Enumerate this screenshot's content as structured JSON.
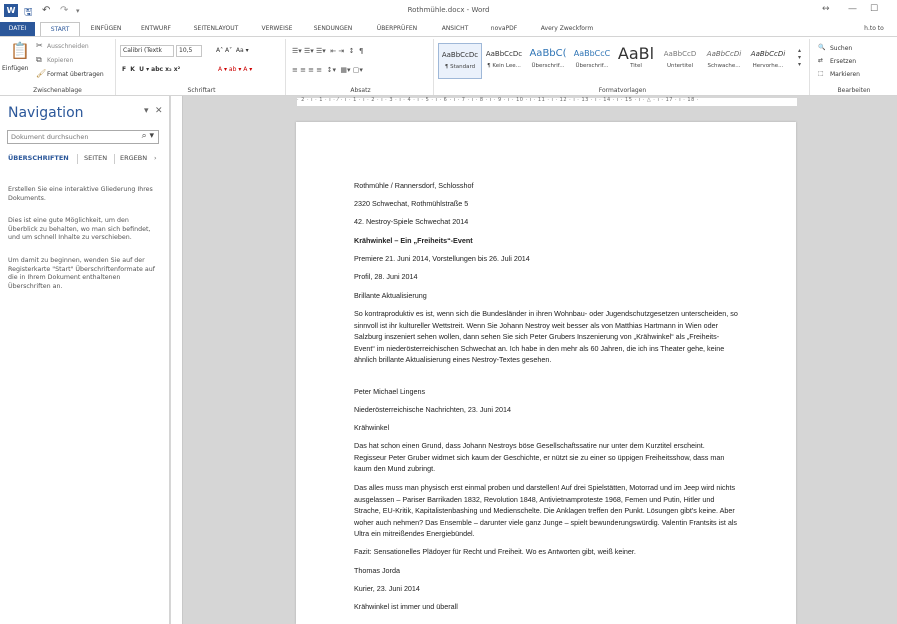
{
  "window": {
    "title": "Rothmühle.docx - Word",
    "user": "h.to to"
  },
  "tabs": [
    "DATEI",
    "START",
    "EINFÜGEN",
    "ENTWURF",
    "SEITENLAYOUT",
    "VERWEISE",
    "SENDUNGEN",
    "ÜBERPRÜFEN",
    "ANSICHT",
    "novaPDF",
    "Avery Zweckform"
  ],
  "ribbon": {
    "clipboard": {
      "paste": "Einfügen",
      "cut": "Ausschneiden",
      "copy": "Kopieren",
      "format_painter": "Format übertragen",
      "label": "Zwischenablage"
    },
    "font": {
      "name": "Calibri (Textk",
      "size": "10,5",
      "label": "Schriftart"
    },
    "paragraph": {
      "label": "Absatz"
    },
    "styles": {
      "label": "Formatvorlagen",
      "items": [
        {
          "preview": "AaBbCcDc",
          "name": "¶ Standard"
        },
        {
          "preview": "AaBbCcDc",
          "name": "¶ Kein Lee..."
        },
        {
          "preview": "AaBbC(",
          "name": "Überschrif..."
        },
        {
          "preview": "AaBbCcC",
          "name": "Überschrif..."
        },
        {
          "preview": "AaBl",
          "name": "Titel"
        },
        {
          "preview": "AaBbCcD",
          "name": "Untertitel"
        },
        {
          "preview": "AaBbCcDi",
          "name": "Schwache..."
        },
        {
          "preview": "AaBbCcDi",
          "name": "Hervorhe..."
        }
      ]
    },
    "editing": {
      "find": "Suchen",
      "replace": "Ersetzen",
      "select": "Markieren",
      "label": "Bearbeiten"
    }
  },
  "navigation": {
    "title": "Navigation",
    "search_placeholder": "Dokument durchsuchen",
    "tabs": [
      "ÜBERSCHRIFTEN",
      "SEITEN",
      "ERGEBN"
    ],
    "help": [
      "Erstellen Sie eine interaktive Gliederung Ihres Dokuments.",
      "Dies ist eine gute Möglichkeit, um den Überblick zu behalten, wo man sich befindet, und um schnell Inhalte zu verschieben.",
      "Um damit zu beginnen, wenden Sie auf der Registerkarte \"Start\" Überschriftenformate auf die in Ihrem Dokument enthaltenen Überschriften an."
    ]
  },
  "ruler": {
    "h": "· 2 · ı · 1 · ı · ⁄ · ı · 1 · ı · 2 · ı · 3 · ı · 4 · ı · 5 · ı · 6 · ı · 7 · ı · 8 · ı · 9 · ı · 10 · ı · 11 · ı · 12 · ı · 13 · ı · 14 · ı · 15 · ı · △ · ı · 17 · ı · 18 ·"
  },
  "document": {
    "paragraphs": [
      "Rothmühle / Rannersdorf, Schlosshof",
      "2320 Schwechat, Rothmühlstraße 5",
      "42. Nestroy-Spiele Schwechat 2014",
      "Krähwinkel – Ein „Freiheits“-Event",
      "Premiere 21. Juni 2014, Vorstellungen bis 26. Juli 2014",
      "Profil, 28. Juni 2014",
      "Brillante Aktualisierung",
      "So kontraproduktiv es ist, wenn sich die Bundesländer in ihren Wohnbau- oder Jugendschutzgesetzen unterscheiden, so sinnvoll ist ihr kultureller Wettstreit. Wenn Sie Johann Nestroy weit besser als von Matthias Hartmann in Wien oder Salzburg inszeniert sehen wollen, dann sehen Sie sich Peter Grubers Inszenierung von „Krähwinkel“ als „Freiheits-Event“ im niederösterreichischen Schwechat an. Ich habe in den mehr als 60 Jahren, die ich ins Theater gehe, keine ähnlich brillante Aktualisierung eines Nestroy-Textes gesehen.",
      "Peter Michael Lingens",
      "Niederösterreichische Nachrichten, 23. Juni 2014",
      "Krähwinkel",
      "Das hat schon einen Grund, dass Johann Nestroys böse Gesellschaftssatire nur unter dem Kurztitel erscheint. Regisseur Peter Gruber widmet sich kaum der Geschichte, er nützt sie zu einer so üppigen Freiheitsshow, dass man kaum den Mund zubringt.",
      "Das alles muss man physisch erst einmal proben und darstellen! Auf drei Spielstätten, Motorrad und im Jeep wird nichts ausgelassen – Pariser Barrikaden 1832, Revolution 1848, Antivietnamproteste 1968, Femen und Putin, Hitler und Strache, EU-Kritik, Kapitalistenbashing und Medienschelte. Die Anklagen treffen den Punkt. Lösungen gibt's keine. Aber woher auch nehmen? Das Ensemble – darunter viele ganz Junge – spielt bewunderungswürdig. Valentin Frantsits ist als Ultra ein mitreißendes Energiebündel.",
      "Fazit: Sensationelles Plädoyer für Recht und Freiheit. Wo es Antworten gibt, weiß keiner.",
      "Thomas Jorda",
      "Kurier, 23. Juni 2014",
      "Krähwinkel ist immer und überall"
    ]
  }
}
